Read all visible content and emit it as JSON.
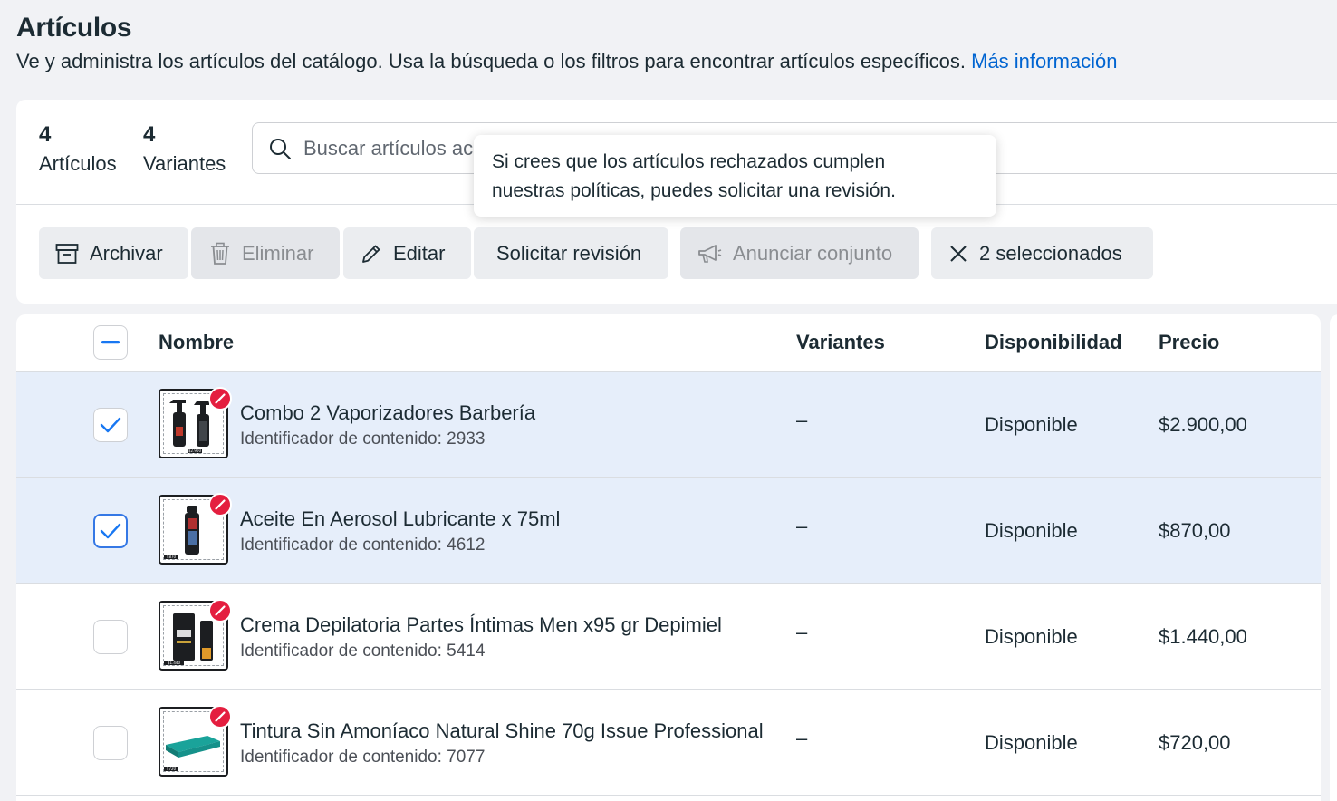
{
  "header": {
    "title": "Artículos",
    "subtitle": "Ve y administra los artículos del catálogo. Usa la búsqueda o los filtros para encontrar artículos específicos.",
    "learn_more": "Más información"
  },
  "stats": {
    "items_count": "4",
    "items_label": "Artículos",
    "variants_count": "4",
    "variants_label": "Variantes"
  },
  "search": {
    "placeholder": "Buscar artículos ac"
  },
  "toolbar": {
    "archive": "Archivar",
    "delete": "Eliminar",
    "edit": "Editar",
    "request_review": "Solicitar revisión",
    "advertise_set": "Anunciar conjunto",
    "selected": "2 seleccionados"
  },
  "tooltip": {
    "line1": "Si crees que los artículos rechazados cumplen",
    "line2": "nuestras políticas, puedes solicitar una revisión."
  },
  "table": {
    "columns": {
      "name": "Nombre",
      "variants": "Variantes",
      "availability": "Disponibilidad",
      "price": "Precio"
    },
    "rows": [
      {
        "name": "Combo 2 Vaporizadores Barbería",
        "content_id": "Identificador de contenido: 2933",
        "variants": "–",
        "availability": "Disponible",
        "price": "$2.900,00",
        "checked": true,
        "thumb_price": "$2.900"
      },
      {
        "name": "Aceite En Aerosol Lubricante x 75ml",
        "content_id": "Identificador de contenido: 4612",
        "variants": "–",
        "availability": "Disponible",
        "price": "$870,00",
        "checked": true,
        "thumb_price": "$870"
      },
      {
        "name": "Crema Depilatoria Partes Íntimas Men x95 gr Depimiel",
        "content_id": "Identificador de contenido: 5414",
        "variants": "–",
        "availability": "Disponible",
        "price": "$1.440,00",
        "checked": false,
        "thumb_price": "$1.440"
      },
      {
        "name": "Tintura Sin Amoníaco Natural Shine 70g Issue Professional",
        "content_id": "Identificador de contenido: 7077",
        "variants": "–",
        "availability": "Disponible",
        "price": "$720,00",
        "checked": false,
        "thumb_price": "$720"
      }
    ]
  },
  "colors": {
    "accent": "#0064d1",
    "checkbox": "#1877f2",
    "selected_row": "#e6eefa",
    "reject": "#e41e3f"
  }
}
